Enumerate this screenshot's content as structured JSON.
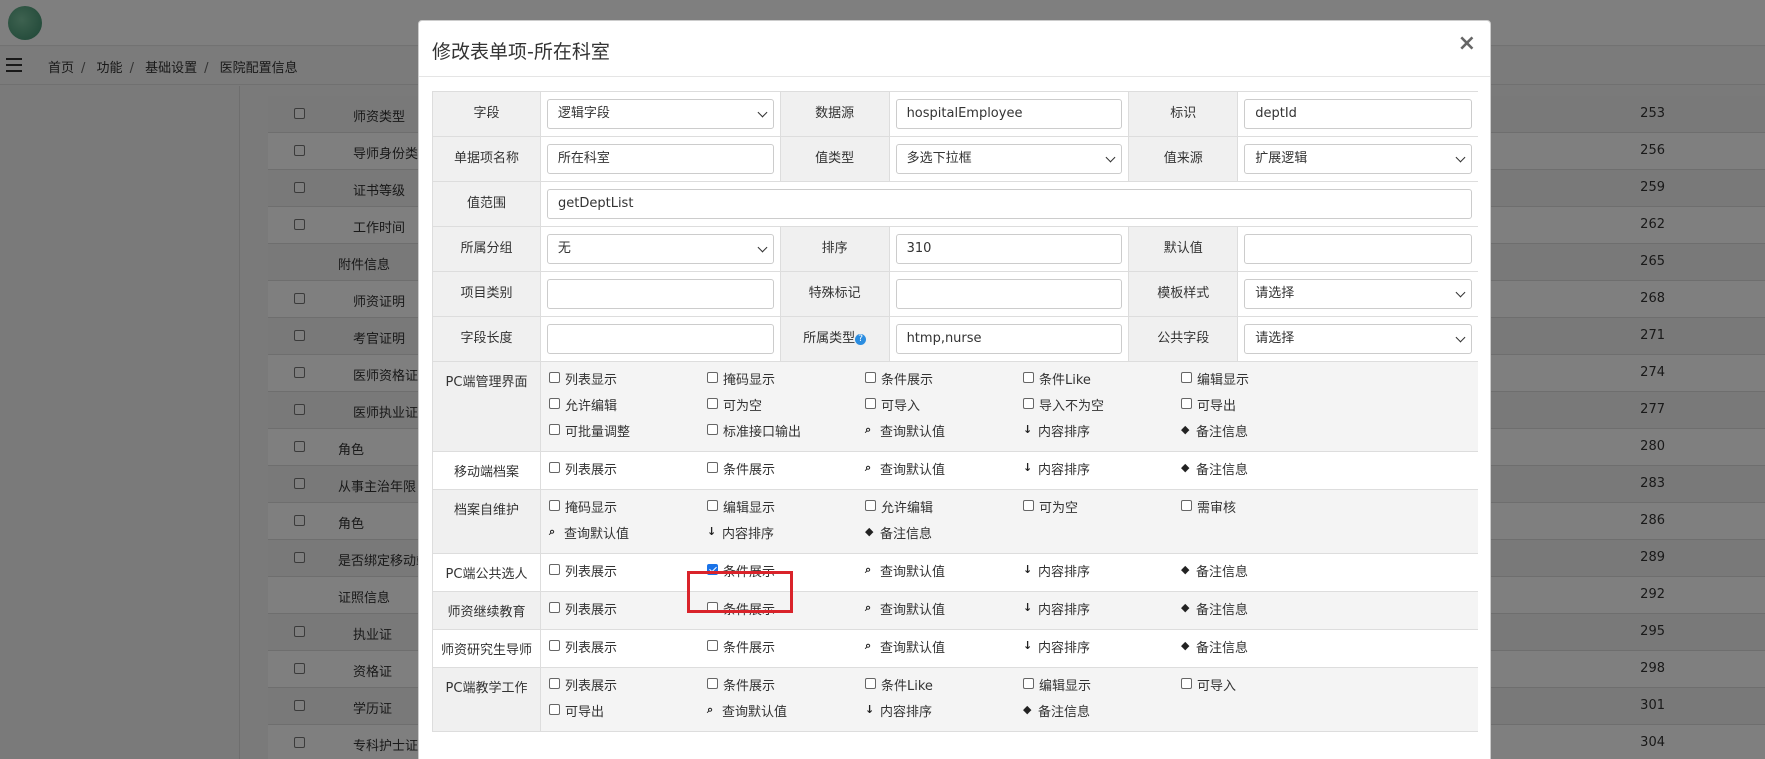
{
  "window": {
    "title": "修改表单项-所在科室"
  },
  "breadcrumb": [
    "首页",
    "功能",
    "基础设置",
    "医院配置信息"
  ],
  "background_rows": [
    {
      "name": "师资类型",
      "indent": true,
      "num": "253"
    },
    {
      "name": "导师身份类",
      "indent": true,
      "num": "256"
    },
    {
      "name": "证书等级",
      "indent": true,
      "num": "259"
    },
    {
      "name": "工作时间",
      "indent": true,
      "num": "262"
    },
    {
      "name": "附件信息",
      "indent": false,
      "num": "265",
      "nocheck": true
    },
    {
      "name": "师资证明",
      "indent": true,
      "num": "268"
    },
    {
      "name": "考官证明",
      "indent": true,
      "num": "271"
    },
    {
      "name": "医师资格证",
      "indent": true,
      "num": "274"
    },
    {
      "name": "医师执业证",
      "indent": true,
      "num": "277"
    },
    {
      "name": "角色",
      "indent": false,
      "num": "280"
    },
    {
      "name": "从事主治年限",
      "indent": false,
      "num": "283"
    },
    {
      "name": "角色",
      "indent": false,
      "num": "286"
    },
    {
      "name": "是否绑定移动端",
      "indent": false,
      "num": "289"
    },
    {
      "name": "证照信息",
      "indent": false,
      "num": "292",
      "nocheck": true
    },
    {
      "name": "执业证",
      "indent": true,
      "num": "295"
    },
    {
      "name": "资格证",
      "indent": true,
      "num": "298"
    },
    {
      "name": "学历证",
      "indent": true,
      "num": "301"
    },
    {
      "name": "专科护士证",
      "indent": true,
      "num": "304"
    }
  ],
  "form": {
    "field_label": "字段",
    "field_value": "逻辑字段",
    "datasource_label": "数据源",
    "datasource_value": "hospitalEmployee",
    "id_label": "标识",
    "id_value": "deptId",
    "name_label": "单据项名称",
    "name_value": "所在科室",
    "valtype_label": "值类型",
    "valtype_value": "多选下拉框",
    "valsrc_label": "值来源",
    "valsrc_value": "扩展逻辑",
    "range_label": "值范围",
    "range_value": "getDeptList",
    "group_label": "所属分组",
    "group_value": "无",
    "order_label": "排序",
    "order_value": "310",
    "default_label": "默认值",
    "default_value": "",
    "category_label": "项目类别",
    "category_value": "",
    "special_label": "特殊标记",
    "special_value": "",
    "template_label": "模板样式",
    "template_value": "请选择",
    "length_label": "字段长度",
    "length_value": "",
    "type_label": "所属类型",
    "type_value": "htmp,nurse",
    "public_label": "公共字段",
    "public_value": "请选择"
  },
  "option_rows": [
    {
      "label": "PC端管理界面",
      "gray": true,
      "options": [
        {
          "t": "列表显示",
          "k": "cb"
        },
        {
          "t": "掩码显示",
          "k": "cb"
        },
        {
          "t": "条件展示",
          "k": "cb"
        },
        {
          "t": "条件Like",
          "k": "cb"
        },
        {
          "t": "编辑显示",
          "k": "cb"
        },
        {
          "t": "允许编辑",
          "k": "cb"
        },
        {
          "t": "可为空",
          "k": "cb"
        },
        {
          "t": "可导入",
          "k": "cb"
        },
        {
          "t": "导入不为空",
          "k": "cb"
        },
        {
          "t": "可导出",
          "k": "cb"
        },
        {
          "t": "可批量调整",
          "k": "cb"
        },
        {
          "t": "标准接口输出",
          "k": "cb"
        },
        {
          "t": "查询默认值",
          "k": "search"
        },
        {
          "t": "内容排序",
          "k": "sort"
        },
        {
          "t": "备注信息",
          "k": "tag"
        }
      ]
    },
    {
      "label": "移动端档案",
      "gray": false,
      "options": [
        {
          "t": "列表展示",
          "k": "cb"
        },
        {
          "t": "条件展示",
          "k": "cb"
        },
        {
          "t": "查询默认值",
          "k": "search"
        },
        {
          "t": "内容排序",
          "k": "sort"
        },
        {
          "t": "备注信息",
          "k": "tag"
        }
      ]
    },
    {
      "label": "档案自维护",
      "gray": true,
      "options": [
        {
          "t": "掩码显示",
          "k": "cb"
        },
        {
          "t": "编辑显示",
          "k": "cb"
        },
        {
          "t": "允许编辑",
          "k": "cb"
        },
        {
          "t": "可为空",
          "k": "cb"
        },
        {
          "t": "需审核",
          "k": "cb"
        },
        {
          "t": "查询默认值",
          "k": "search"
        },
        {
          "t": "内容排序",
          "k": "sort"
        },
        {
          "t": "备注信息",
          "k": "tag"
        }
      ]
    },
    {
      "label": "PC端公共选人",
      "gray": false,
      "options": [
        {
          "t": "列表展示",
          "k": "cb"
        },
        {
          "t": "条件展示",
          "k": "cb",
          "checked": true
        },
        {
          "t": "查询默认值",
          "k": "search"
        },
        {
          "t": "内容排序",
          "k": "sort"
        },
        {
          "t": "备注信息",
          "k": "tag"
        }
      ]
    },
    {
      "label": "师资继续教育",
      "gray": true,
      "options": [
        {
          "t": "列表展示",
          "k": "cb"
        },
        {
          "t": "条件展示",
          "k": "cb"
        },
        {
          "t": "查询默认值",
          "k": "search"
        },
        {
          "t": "内容排序",
          "k": "sort"
        },
        {
          "t": "备注信息",
          "k": "tag"
        }
      ]
    },
    {
      "label": "师资研究生导师",
      "gray": false,
      "options": [
        {
          "t": "列表展示",
          "k": "cb"
        },
        {
          "t": "条件展示",
          "k": "cb"
        },
        {
          "t": "查询默认值",
          "k": "search"
        },
        {
          "t": "内容排序",
          "k": "sort"
        },
        {
          "t": "备注信息",
          "k": "tag"
        }
      ]
    },
    {
      "label": "PC端教学工作",
      "gray": true,
      "options": [
        {
          "t": "列表展示",
          "k": "cb"
        },
        {
          "t": "条件展示",
          "k": "cb"
        },
        {
          "t": "条件Like",
          "k": "cb"
        },
        {
          "t": "编辑显示",
          "k": "cb"
        },
        {
          "t": "可导入",
          "k": "cb"
        },
        {
          "t": "可导出",
          "k": "cb"
        },
        {
          "t": "查询默认值",
          "k": "search"
        },
        {
          "t": "内容排序",
          "k": "sort"
        },
        {
          "t": "备注信息",
          "k": "tag"
        }
      ]
    }
  ]
}
